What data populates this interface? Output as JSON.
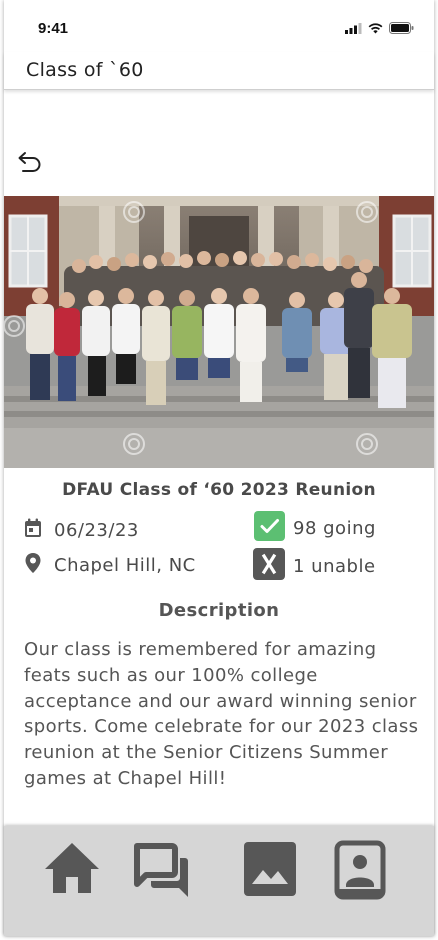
{
  "status_bar": {
    "time": "9:41"
  },
  "header": {
    "title": "Class of `60"
  },
  "event": {
    "title": "DFAU Class of ‘60 2023 Reunion",
    "date": "06/23/23",
    "location": "Chapel Hill, NC",
    "going": "98 going",
    "unable": "1 unable"
  },
  "description": {
    "heading": "Description",
    "text": "Our class is remembered for amazing feats such as our 100% college acceptance and our award winning senior sports. Come celebrate for our 2023 class reunion at the Senior Citizens Summer games at Chapel Hill!"
  },
  "icons": {
    "back": "back-arrow-icon",
    "calendar": "calendar-icon",
    "location": "location-pin-icon",
    "going": "check-icon",
    "unable": "x-icon",
    "nav": [
      "home-icon",
      "chat-icon",
      "gallery-icon",
      "contacts-icon"
    ]
  },
  "colors": {
    "accent_green": "#5cbf72",
    "icon_gray": "#575757",
    "nav_bg": "#d6d6d6"
  }
}
